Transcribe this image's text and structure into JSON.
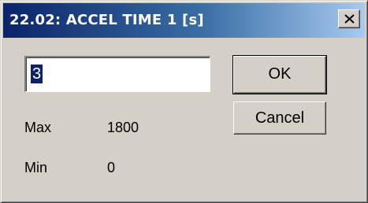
{
  "dialog": {
    "title": "22.02: ACCEL TIME 1 [s]",
    "close_glyph": "close-icon"
  },
  "input": {
    "value": "3"
  },
  "buttons": {
    "ok_label": "OK",
    "cancel_label": "Cancel"
  },
  "limits": {
    "max_label": "Max",
    "max_value": "1800",
    "min_label": "Min",
    "min_value": "0"
  },
  "colors": {
    "titlebar_start": "#0a246a",
    "titlebar_end": "#a6caf0",
    "dialog_face": "#d4d0c8",
    "selection": "#0a246a"
  }
}
